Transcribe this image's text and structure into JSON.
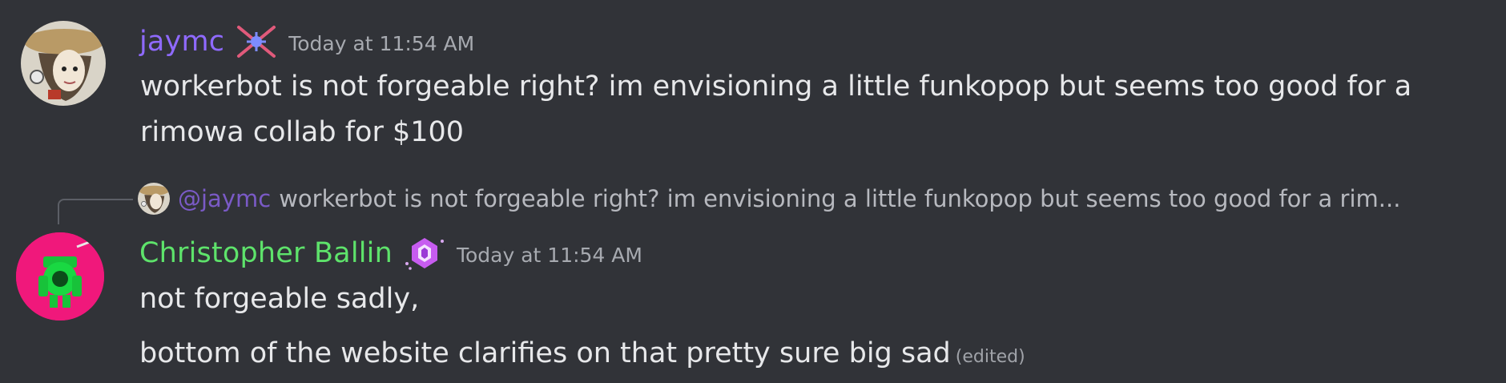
{
  "messages": [
    {
      "username": "jaymc",
      "badge_icon": "pink-x-star-badge-icon",
      "timestamp": "Today at 11:54 AM",
      "lines": [
        "workerbot is not forgeable right? im envisioning a little funkopop but seems too good for a",
        "rimowa collab for $100"
      ]
    },
    {
      "reply": {
        "mention": "@jaymc",
        "preview": "workerbot is not forgeable right? im envisioning a little funkopop but seems too good for a rim..."
      },
      "username": "Christopher Ballin",
      "badge_icon": "purple-gem-badge-icon",
      "timestamp": "Today at 11:54 AM",
      "lines": [
        "not forgeable sadly,",
        "bottom of the website clarifies on that pretty sure big sad"
      ],
      "edited_label": "(edited)"
    }
  ],
  "colors": {
    "background": "#313338",
    "jaymc_name": "#8f6aff",
    "chris_name": "#5ee36b",
    "mention": "#7a5ac6",
    "text": "#e7e8ea",
    "muted": "#a7aab0"
  }
}
